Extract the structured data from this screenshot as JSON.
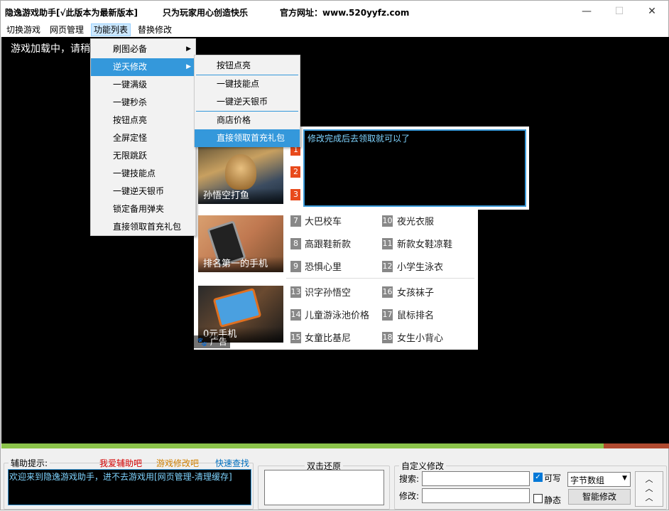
{
  "window": {
    "title_app": "隐逸游戏助手[√此版本为最新版本]",
    "title_slogan": "只为玩家用心创造快乐",
    "title_site": "官方网址：www.520yyfz.com",
    "minimize_glyph": "—",
    "maximize_glyph": "☐",
    "close_glyph": "✕"
  },
  "menubar": {
    "items": [
      "切换游戏",
      "网页管理",
      "功能列表",
      "替换修改"
    ]
  },
  "game": {
    "loading_text": "游戏加载中，请稍"
  },
  "dropdown": {
    "items": [
      "刷图必备",
      "逆天修改",
      "一键满级",
      "一键秒杀",
      "按钮点亮",
      "全屏定怪",
      "无限跳跃",
      "一键技能点",
      "一键逆天银币",
      "锁定备用弹夹",
      "直接领取首充礼包"
    ],
    "arrow": "▶"
  },
  "submenu": {
    "items": [
      "按钮点亮",
      "一键技能点",
      "一键逆天银币",
      "商店价格",
      "直接领取首充礼包"
    ]
  },
  "tip": {
    "text": "修改完成后去领取就可以了"
  },
  "ad": {
    "thumbs": [
      "孙悟空打鱼",
      "排名第一的手机",
      "0元手机"
    ],
    "badge": "广告",
    "top_nums": [
      "1",
      "2",
      "3"
    ],
    "list_left": [
      {
        "n": "7",
        "t": "大巴校车"
      },
      {
        "n": "8",
        "t": "高跟鞋新款"
      },
      {
        "n": "9",
        "t": "恐惧心里"
      },
      {
        "n": "13",
        "t": "识字孙悟空"
      },
      {
        "n": "14",
        "t": "儿童游泳池价格"
      },
      {
        "n": "15",
        "t": "女童比基尼"
      }
    ],
    "list_right": [
      {
        "n": "10",
        "t": "夜光衣服"
      },
      {
        "n": "11",
        "t": "新款女鞋凉鞋"
      },
      {
        "n": "12",
        "t": "小学生泳衣"
      },
      {
        "n": "16",
        "t": "女孩袜子"
      },
      {
        "n": "17",
        "t": "鼠标排名"
      },
      {
        "n": "18",
        "t": "女生小背心"
      }
    ]
  },
  "bottom": {
    "helper_legend": "辅助提示:",
    "link1": "我爱辅助吧",
    "link2": "游戏修改吧",
    "link3": "快速查找",
    "helper_text": "欢迎来到隐逸游戏助手，进不去游戏用[网页管理-清理缓存]",
    "restore_legend": "双击还原",
    "custom_legend": "自定义修改",
    "search_label": "搜索:",
    "modify_label": "修改:",
    "writable_label": "可写",
    "static_label": "静态",
    "type_select": "字节数组",
    "smart_button": "智能修改",
    "up_glyph": "︿"
  },
  "colors": {
    "accent": "#3498db",
    "link1": "#d40000",
    "link2": "#d08000",
    "link3": "#0070c0",
    "helper_text": "#7fd4ff"
  }
}
